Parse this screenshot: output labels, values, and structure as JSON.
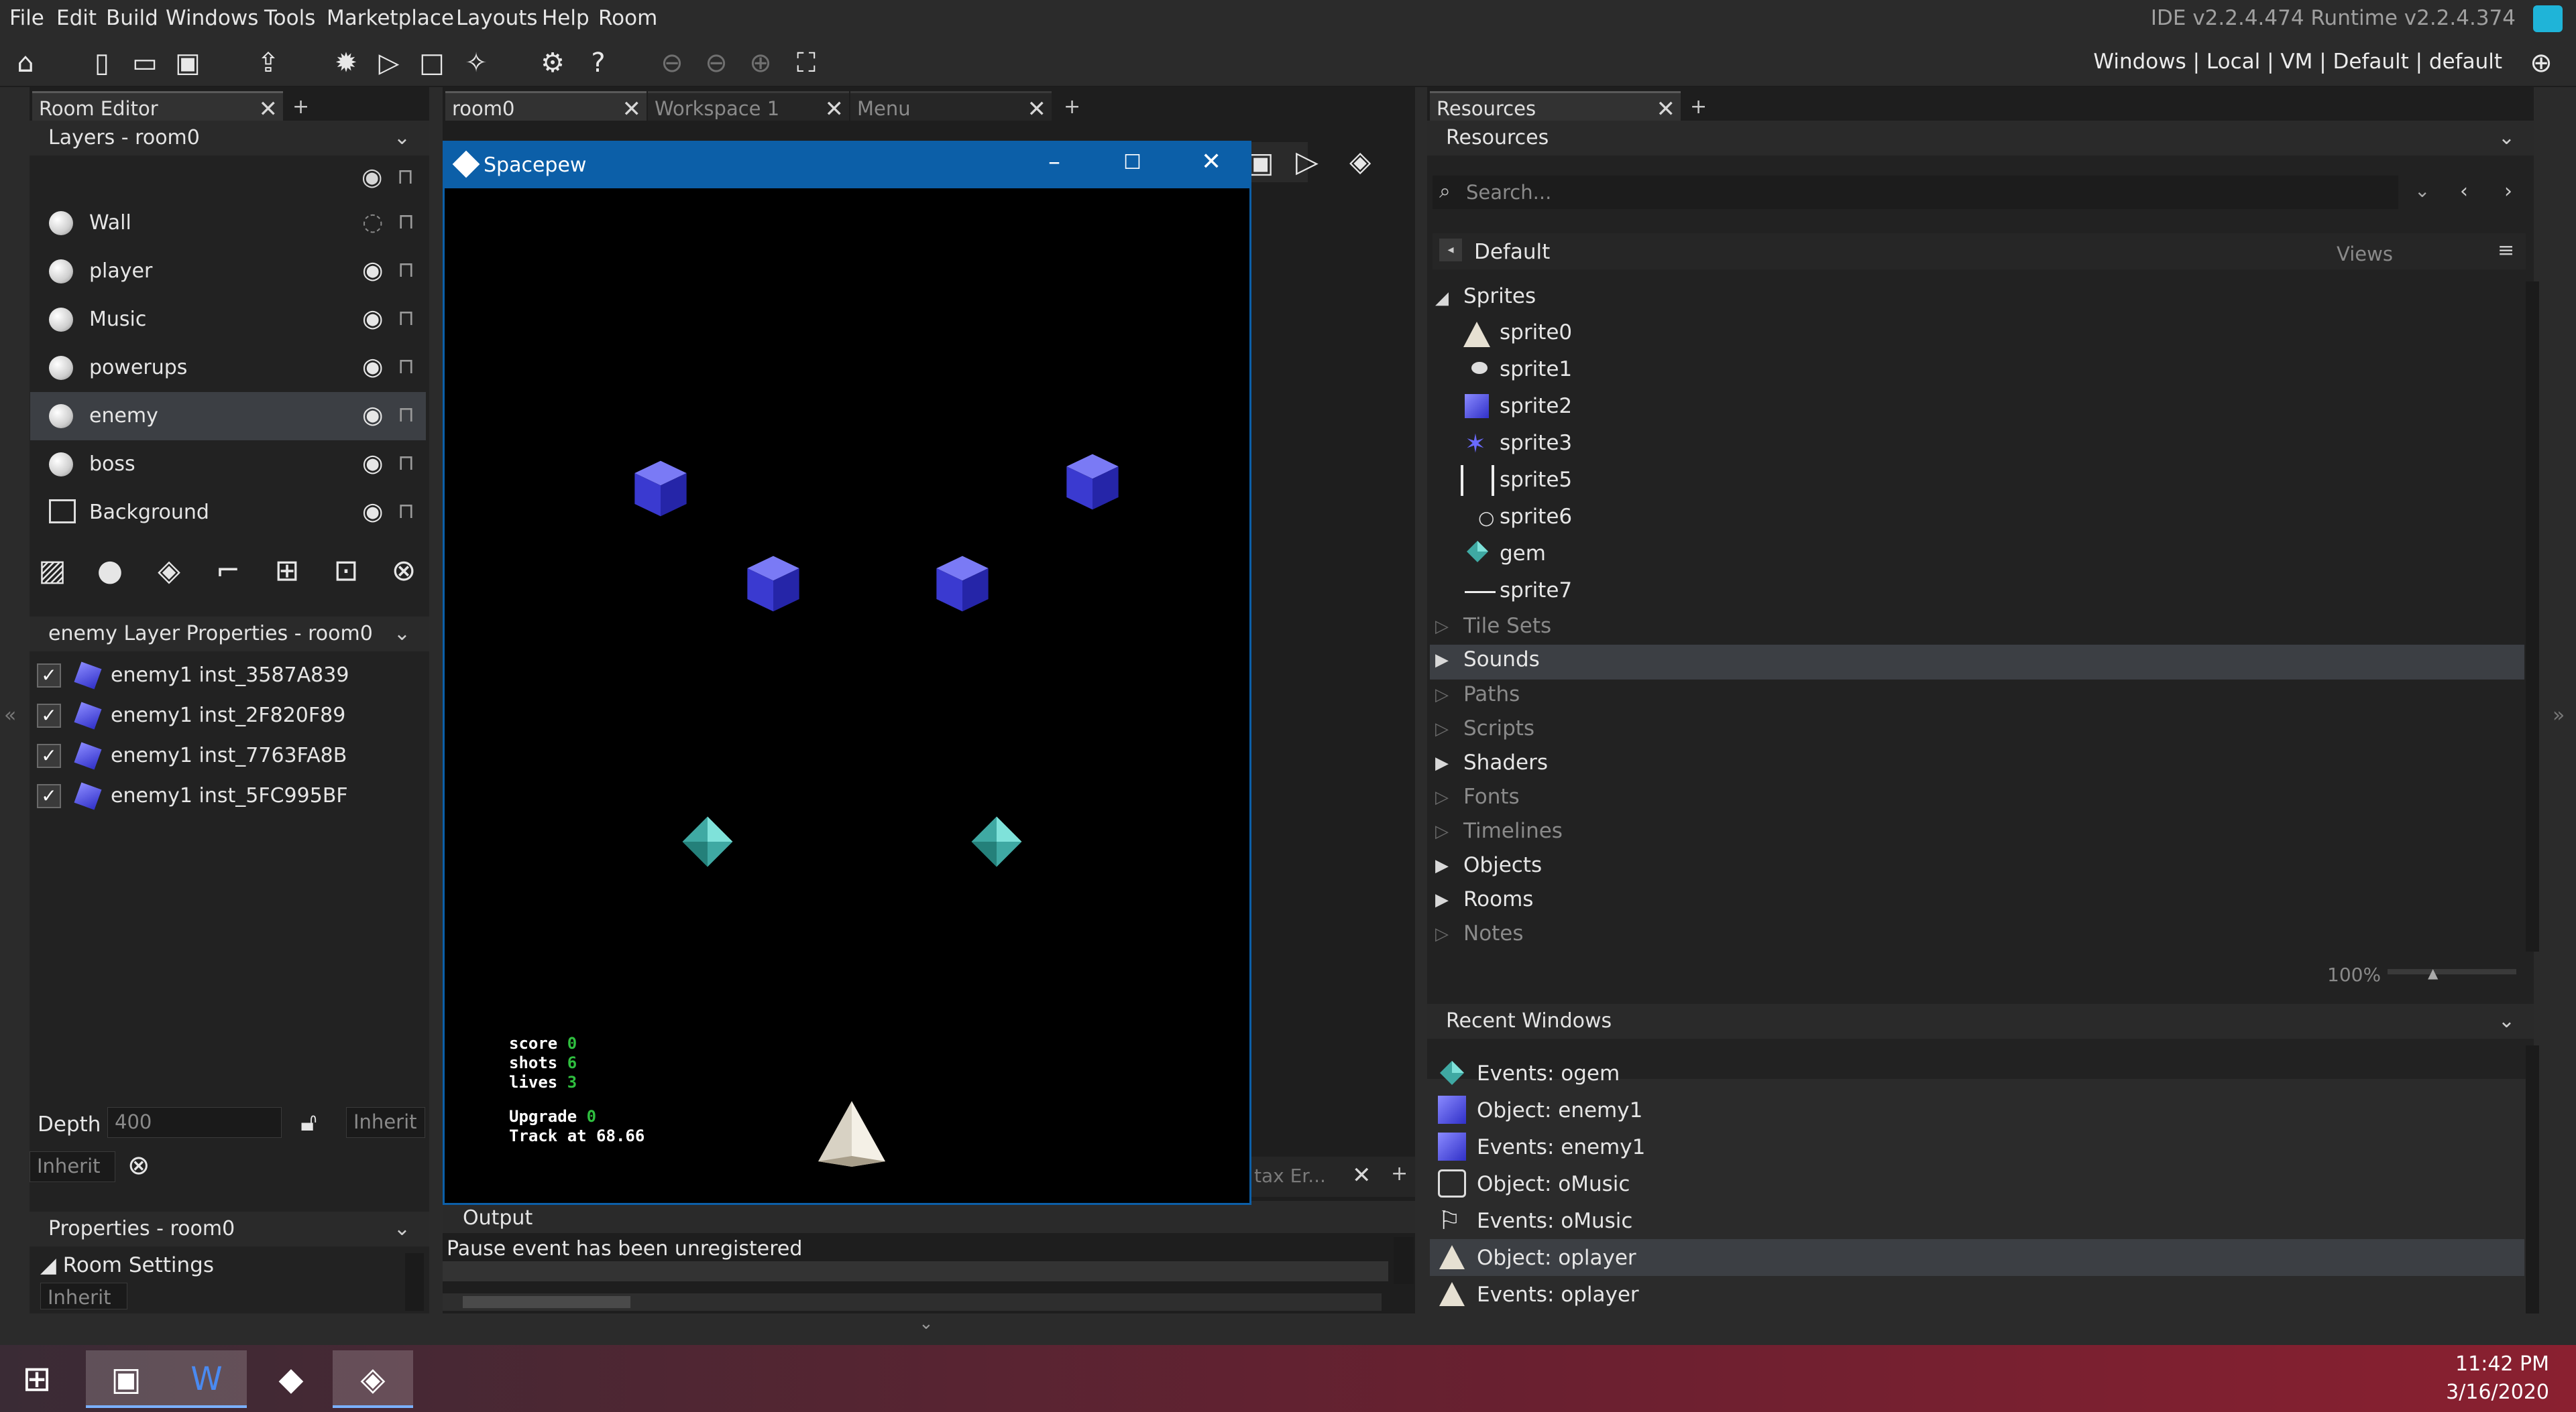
{
  "menu": [
    "File",
    "Edit",
    "Build",
    "Windows",
    "Tools",
    "Marketplace",
    "Layouts",
    "Help",
    "Room"
  ],
  "version_label": "IDE v2.2.4.474  Runtime v2.2.4.374",
  "targets": "Windows | Local | VM | Default | default",
  "left_panel": {
    "tab_label": "Room Editor",
    "layers_header": "Layers - room0",
    "layers": [
      {
        "name": "Wall",
        "visible": false
      },
      {
        "name": "player",
        "visible": true
      },
      {
        "name": "Music",
        "visible": true
      },
      {
        "name": "powerups",
        "visible": true
      },
      {
        "name": "enemy",
        "visible": true,
        "selected": true
      },
      {
        "name": "boss",
        "visible": true
      },
      {
        "name": "Background",
        "visible": true
      }
    ],
    "layer_props_header": "enemy Layer Properties - room0",
    "instances": [
      "enemy1 inst_3587A839",
      "enemy1 inst_2F820F89",
      "enemy1 inst_7763FA8B",
      "enemy1 inst_5FC995BF"
    ],
    "depth_label": "Depth",
    "depth_value": "400",
    "inherit_label": "Inherit",
    "properties_header": "Properties - room0",
    "room_settings": "Room Settings"
  },
  "center": {
    "tabs": [
      "room0",
      "Workspace 1",
      "Menu"
    ],
    "game_window_title": "Spacepew",
    "hud": {
      "score_label": "score",
      "score": "0",
      "shots_label": "shots",
      "shots": "6",
      "lives_label": "lives",
      "lives": "3",
      "upgrade_label": "Upgrade",
      "upgrade": "0",
      "track_line": "Track at 68.66"
    },
    "syntax_tab": "tax Er...",
    "output_header": "Output",
    "output_line": "Pause event has been unregistered"
  },
  "right_panel": {
    "tab_label": "Resources",
    "header": "Resources",
    "search_placeholder": "Search...",
    "group": "Default",
    "views": "Views",
    "sprites_label": "Sprites",
    "sprites": [
      "sprite0",
      "sprite1",
      "sprite2",
      "sprite3",
      "sprite5",
      "sprite6",
      "gem",
      "sprite7"
    ],
    "folders": [
      {
        "name": "Tile Sets",
        "has_items": false
      },
      {
        "name": "Sounds",
        "has_items": true,
        "selected": true
      },
      {
        "name": "Paths",
        "has_items": false
      },
      {
        "name": "Scripts",
        "has_items": false
      },
      {
        "name": "Shaders",
        "has_items": true
      },
      {
        "name": "Fonts",
        "has_items": false
      },
      {
        "name": "Timelines",
        "has_items": false
      },
      {
        "name": "Objects",
        "has_items": true
      },
      {
        "name": "Rooms",
        "has_items": true
      },
      {
        "name": "Notes",
        "has_items": false
      }
    ],
    "zoom": "100%",
    "recent_header": "Recent Windows",
    "recent": [
      {
        "label": "Events: ogem",
        "icon": "gem-icon"
      },
      {
        "label": "Object: enemy1",
        "icon": "cube-icon"
      },
      {
        "label": "Events: enemy1",
        "icon": "cube-icon"
      },
      {
        "label": "Object: oMusic",
        "icon": "blank-icon"
      },
      {
        "label": "Events: oMusic",
        "icon": "flag-icon"
      },
      {
        "label": "Object: oplayer",
        "icon": "triangle-icon",
        "selected": true
      },
      {
        "label": "Events: oplayer",
        "icon": "triangle-icon"
      }
    ]
  },
  "taskbar": {
    "time": "11:42 PM",
    "date": "3/16/2020"
  }
}
